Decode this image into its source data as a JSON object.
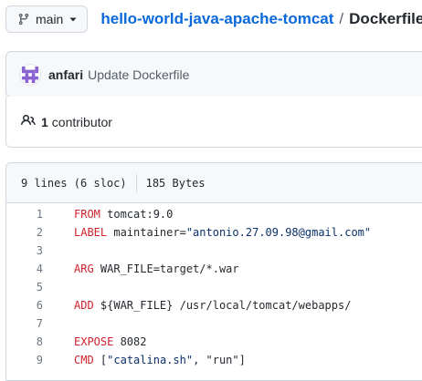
{
  "branch": {
    "label": "main"
  },
  "breadcrumb": {
    "repo": "hello-world-java-apache-tomcat",
    "separator": "/",
    "file": "Dockerfile"
  },
  "commit": {
    "author": "anfari",
    "message": "Update Dockerfile"
  },
  "contributors": {
    "count": "1",
    "label": "contributor"
  },
  "file_info": {
    "lines": "9 lines (6 sloc)",
    "size": "185 Bytes"
  },
  "code_lines": [
    {
      "num": "1",
      "kw": "FROM",
      "rest": " tomcat:9.0",
      "str": "",
      "tail": ""
    },
    {
      "num": "2",
      "kw": "LABEL",
      "rest": " maintainer=",
      "str": "\"antonio.27.09.98@gmail.com\"",
      "tail": ""
    },
    {
      "num": "3",
      "kw": "",
      "rest": "",
      "str": "",
      "tail": ""
    },
    {
      "num": "4",
      "kw": "ARG",
      "rest": " WAR_FILE=target/*.war",
      "str": "",
      "tail": ""
    },
    {
      "num": "5",
      "kw": "",
      "rest": "",
      "str": "",
      "tail": ""
    },
    {
      "num": "6",
      "kw": "ADD",
      "rest": " ${WAR_FILE} /usr/local/tomcat/webapps/",
      "str": "",
      "tail": ""
    },
    {
      "num": "7",
      "kw": "",
      "rest": "",
      "str": "",
      "tail": ""
    },
    {
      "num": "8",
      "kw": "EXPOSE",
      "rest": " 8082",
      "str": "",
      "tail": ""
    },
    {
      "num": "9",
      "kw": "CMD",
      "rest": " [",
      "str": "\"catalina.sh\"",
      "tail": ", \"run\"]"
    }
  ],
  "icons": {
    "branch": "git-branch-icon",
    "caret": "triangle-down-icon",
    "avatar": "identicon-avatar",
    "people": "people-icon"
  },
  "colors": {
    "link": "#0969da",
    "keyword": "#cf222e",
    "string": "#0a3069",
    "avatar": "#8a63d2"
  }
}
